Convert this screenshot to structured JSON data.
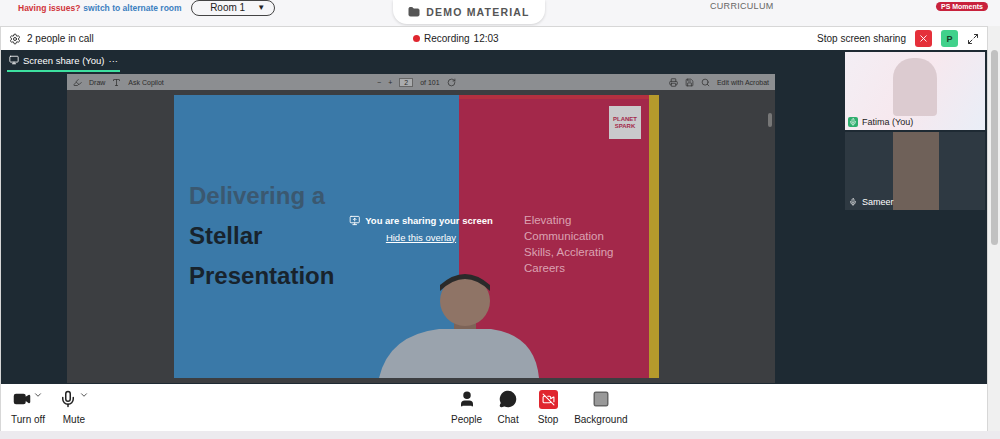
{
  "top_bar": {
    "notice": "Having issues?",
    "link": "switch to alternate room",
    "room": {
      "label": "Room 1",
      "arrow": "▼"
    },
    "material_tab": "DEMO MATERIAL",
    "curriculum": "CURRICULUM",
    "badge": "PS Moments"
  },
  "call_header": {
    "people": "2 people in call",
    "recording": {
      "label": "Recording",
      "time": "12:03",
      "on": true
    },
    "stop_sharing": "Stop screen sharing",
    "avatar": "P"
  },
  "stage_tab": {
    "label": "Screen share (You)",
    "menu": "···",
    "selected": true
  },
  "pdf_toolbar": {
    "draw": "Draw",
    "copilot": "Ask Copilot",
    "minus": "−",
    "plus": "+",
    "page": "2",
    "pages": "of 101",
    "edit": "Edit with Acrobat"
  },
  "slide": {
    "title": [
      {
        "text": "Delivering a",
        "color": "#3b5870"
      },
      {
        "text": "Stellar",
        "color": "#18232c"
      },
      {
        "text": "Presentation",
        "color": "#18232c"
      }
    ],
    "tagline": [
      "Elevating",
      "Communication",
      "Skills, Acclerating",
      "Careers"
    ],
    "logo": [
      "PLANET",
      "SPARK"
    ]
  },
  "overlay": {
    "message": "You are sharing your screen",
    "link": "Hide this overlay"
  },
  "participants": [
    {
      "name": "Fatima (You)",
      "mic_on": true
    },
    {
      "name": "Sameer",
      "mic_on": true
    }
  ],
  "controls": [
    {
      "label": "Turn off",
      "kind": "camera",
      "menu": true,
      "color": "#222222"
    },
    {
      "label": "Mute",
      "kind": "mic",
      "menu": true,
      "color": "#222222"
    },
    {
      "label": "People",
      "kind": "people",
      "menu": false,
      "color": "#222222"
    },
    {
      "label": "Chat",
      "kind": "chat",
      "menu": false,
      "color": "#222222"
    },
    {
      "label": "Stop",
      "kind": "stop",
      "menu": false,
      "color": "#e0262f"
    },
    {
      "label": "Background",
      "kind": "background",
      "menu": false,
      "color": "#222222"
    }
  ]
}
